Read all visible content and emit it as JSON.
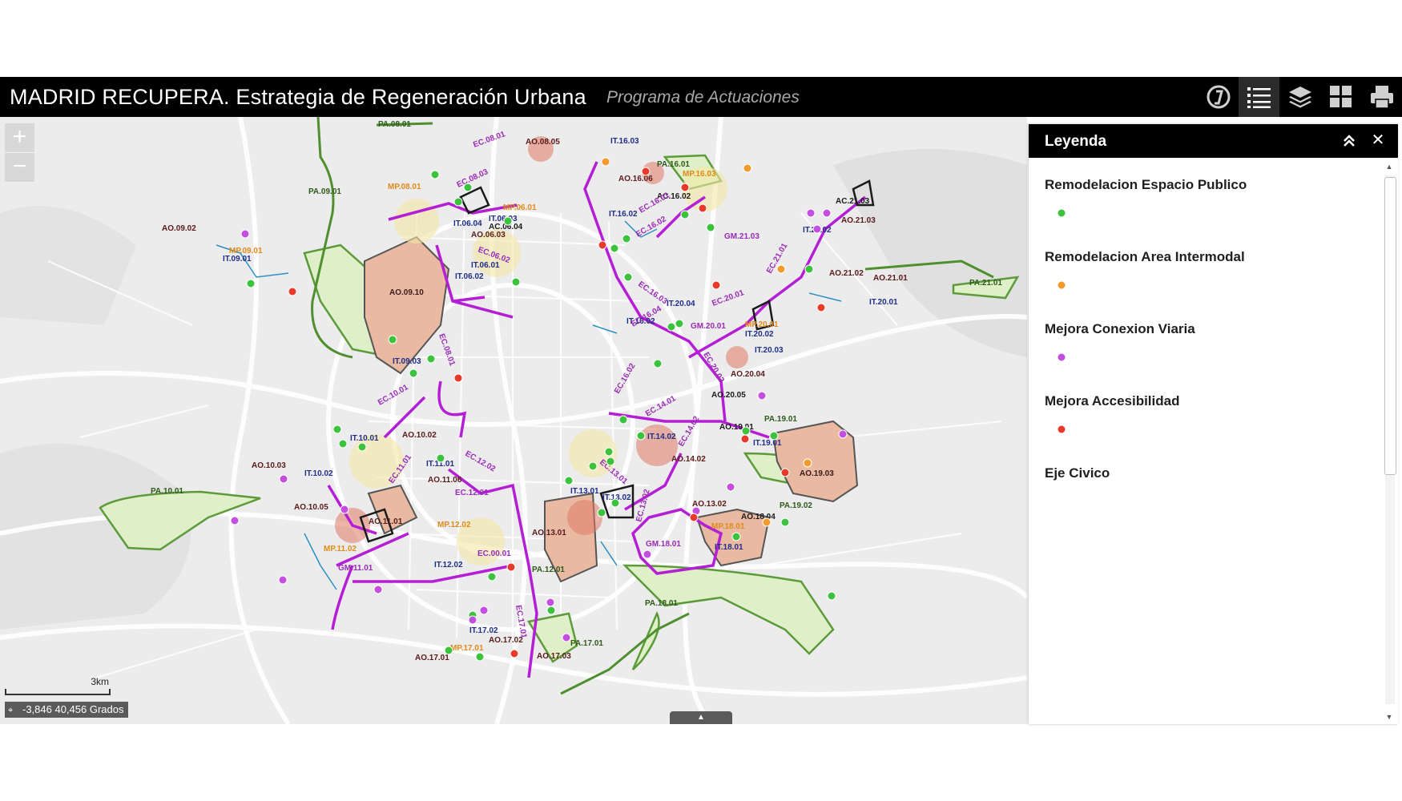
{
  "header": {
    "title": "MADRID RECUPERA. Estrategia de Regeneración Urbana",
    "subtitle": "Programa de Actuaciones",
    "tools": [
      {
        "name": "about-tool",
        "icon": "info-circle-icon"
      },
      {
        "name": "legend-tool",
        "icon": "list-icon",
        "active": true
      },
      {
        "name": "layers-tool",
        "icon": "layers-icon"
      },
      {
        "name": "basemap-tool",
        "icon": "grid-icon"
      },
      {
        "name": "print-tool",
        "icon": "printer-icon"
      }
    ]
  },
  "map": {
    "zoom_in": "+",
    "zoom_out": "−",
    "scale_label": "3km",
    "coordinates": "-3,846 40,456 Grados",
    "attribution_toggle": "▲"
  },
  "legend": {
    "title": "Leyenda",
    "collapse_icon": "double-chevron-up-icon",
    "close": "✕",
    "items": [
      {
        "label": "Remodelacion Espacio Publico",
        "color": "#3cc23c"
      },
      {
        "label": "Remodelacion Area Intermodal",
        "color": "#f29a2c"
      },
      {
        "label": "Mejora Conexion Viaria",
        "color": "#c44ee0"
      },
      {
        "label": "Mejora Accesibilidad",
        "color": "#e83a2a"
      },
      {
        "label": "Eje Civico",
        "color": ""
      }
    ]
  },
  "colors": {
    "green": "#3cc23c",
    "orange": "#f29a2c",
    "purple": "#c44ee0",
    "red": "#e83a2a",
    "axis": "#b41ed4",
    "park": "#dff0c8",
    "area": "#e9b9a2"
  },
  "labels": {
    "navy": [
      "IT.16.03",
      "IT.06.03",
      "IT.06.04",
      "IT.06.01",
      "IT.06.02",
      "IT.09.01",
      "IT.09.03",
      "IT.16.02",
      "IT.20.04",
      "IT.16.02",
      "IT.20.02",
      "IT.20.03",
      "IT.21.02",
      "IT.20.01",
      "IT.10.01",
      "IT.10.02",
      "IT.11.01",
      "IT.14.02",
      "IT.19.01",
      "IT.13.01",
      "IT.13.02",
      "IT.18.01",
      "IT.12.02",
      "IT.17.02"
    ],
    "areas": [
      "AO.08.05",
      "AO.16.06",
      "AC.16.02",
      "AC.21.03",
      "AO.21.03",
      "AO.09.02",
      "AO.06.03",
      "AC.06.04",
      "AO.09.10",
      "AO.21.02",
      "AO.21.01",
      "AO.20.04",
      "AO.20.05",
      "AO.19.01",
      "AO.10.02",
      "AO.10.03",
      "AO.11.06",
      "AO.10.05",
      "AO.11.01",
      "AO.14.02",
      "AO.19.03",
      "AO.13.02",
      "AO.18.04",
      "AO.13.01",
      "AO.17.02",
      "AO.17.03",
      "AO.17.01"
    ],
    "parks": [
      "PA.08.01",
      "PA.09.01",
      "PA.16.01",
      "PA.21.01",
      "PA.19.01",
      "PA.10.01",
      "PA.19.02",
      "PA.12.01",
      "PA.18.01",
      "PA.17.01"
    ],
    "orange": [
      "MP.08.01",
      "MP.16.03",
      "MP.06.01",
      "MP.09.01",
      "MP.20.01",
      "MP.12.02",
      "MP.18.01",
      "MP.11.02",
      "MP.17.01"
    ],
    "purple": [
      "EC.08.01",
      "EC.08.03",
      "EC.06.02",
      "EC.16.01",
      "EC.16.02",
      "GM.21.03",
      "EC.21.01",
      "EC.16.03",
      "EC.20.01",
      "GM.20.01",
      "EC.16.04",
      "EC.08.01",
      "EC.16.02",
      "EC.20.02",
      "EC.10.01",
      "EC.11.01",
      "EC.12.02",
      "EC.12.01",
      "EC.14.01",
      "EC.14.02",
      "EC.13.01",
      "EC.13.02",
      "GM.18.01",
      "GM.11.01",
      "EC.00.01",
      "EC.17.01"
    ]
  }
}
